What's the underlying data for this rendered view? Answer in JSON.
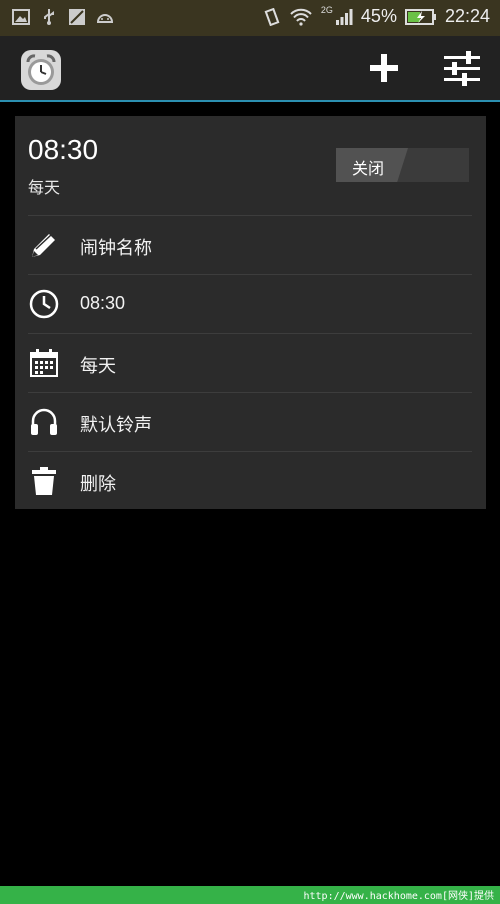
{
  "status_bar": {
    "battery_percent": "45%",
    "clock": "22:24",
    "network": "2G"
  },
  "app_bar": {
    "add_label": "+",
    "icons": [
      "alarm-clock-icon",
      "plus-icon",
      "sliders-icon"
    ]
  },
  "alarm": {
    "time": "08:30",
    "repeat": "每天",
    "toggle_label": "关闭",
    "rows": [
      {
        "icon": "pencil-icon",
        "label": "闹钟名称"
      },
      {
        "icon": "clock-icon",
        "label": "08:30"
      },
      {
        "icon": "calendar-icon",
        "label": "每天"
      },
      {
        "icon": "headphones-icon",
        "label": "默认铃声"
      },
      {
        "icon": "trash-icon",
        "label": "删除"
      }
    ]
  },
  "watermark": "http://www.hackhome.com[网侠]提供",
  "colors": {
    "status_bar": "#3a3520",
    "app_bar": "#222222",
    "accent_line": "#2b8fb0",
    "card": "#2b2b2b",
    "bottom_bar": "#35b248"
  }
}
